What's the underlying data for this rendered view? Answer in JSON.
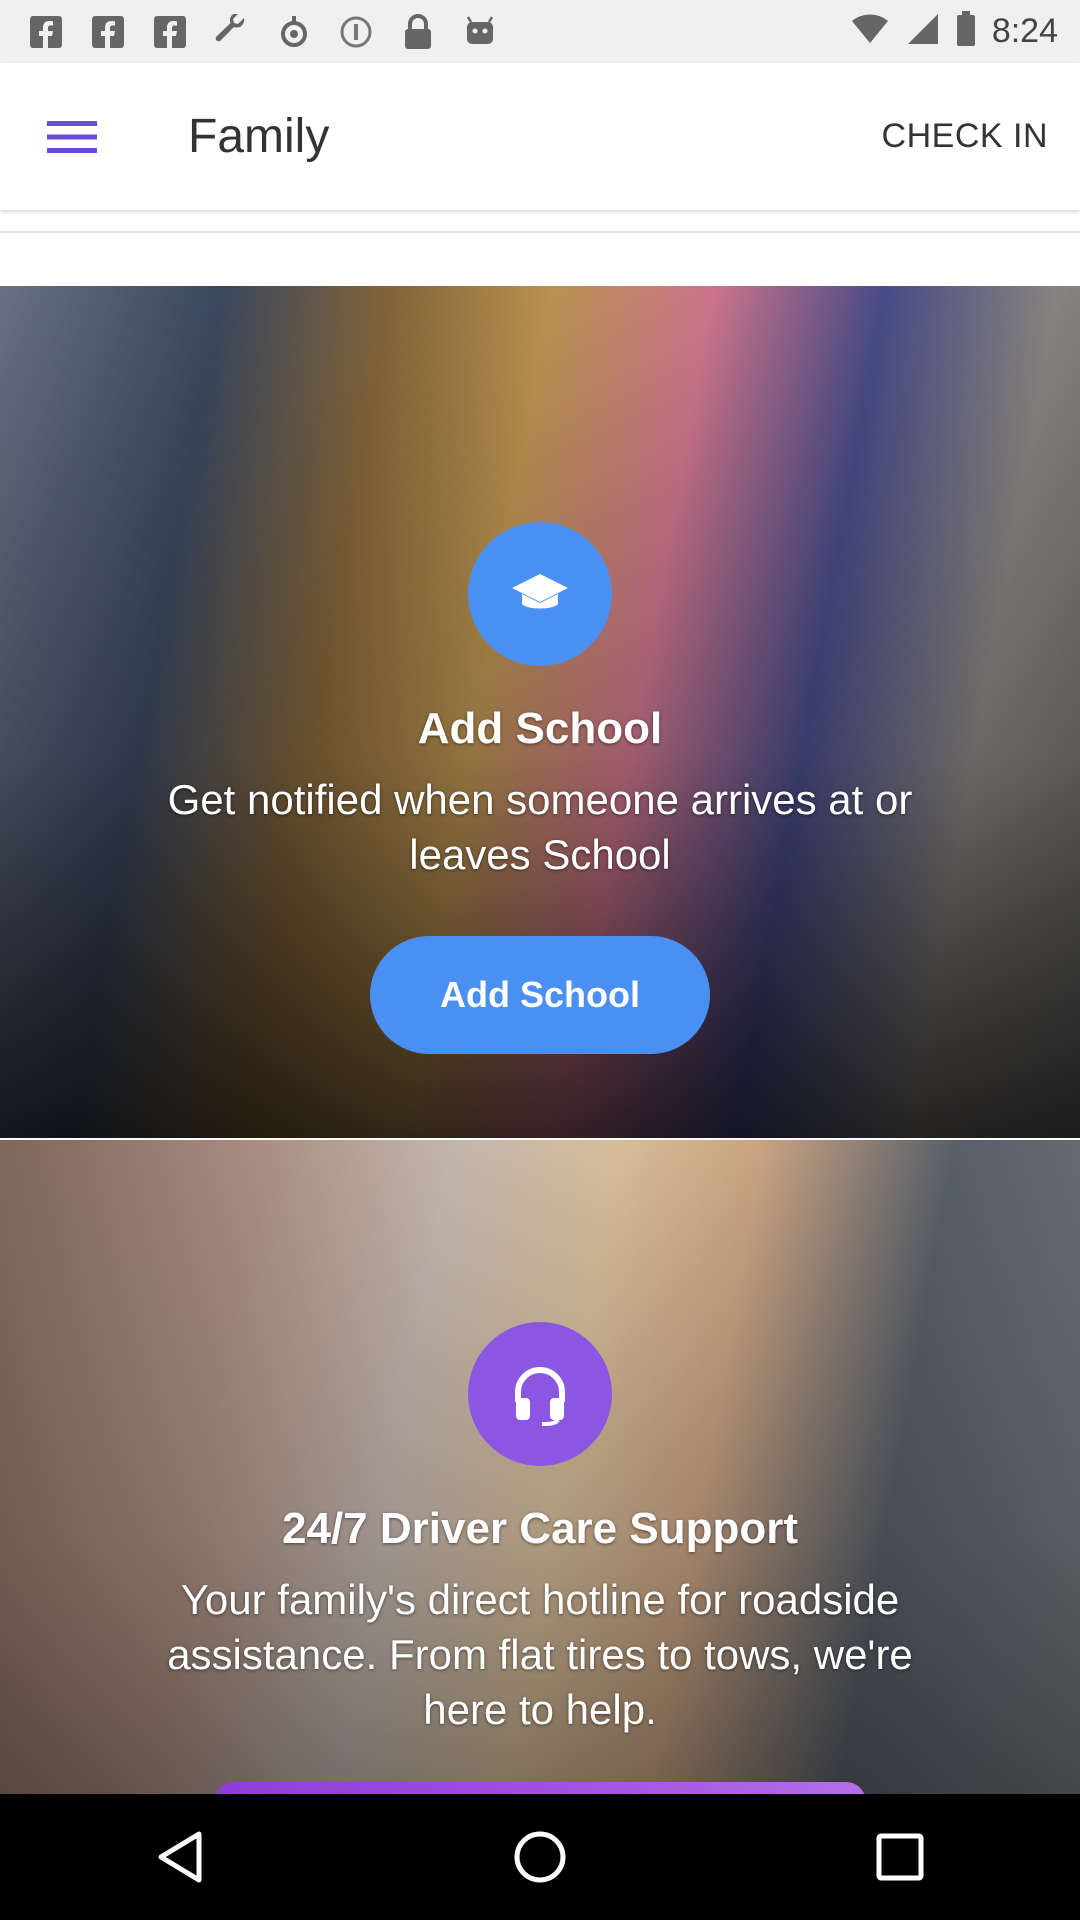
{
  "status_bar": {
    "time": "8:24",
    "icons": [
      "facebook-icon",
      "facebook-icon",
      "facebook-icon",
      "wrench-icon",
      "fake-gps-icon",
      "info-icon",
      "lock-icon",
      "android-icon"
    ]
  },
  "app_bar": {
    "title": "Family",
    "check_in_label": "CHECK IN"
  },
  "school_card": {
    "icon": "graduation-cap-icon",
    "title": "Add School",
    "description": "Get notified when someone arrives at or leaves School",
    "button_label": "Add School",
    "accent": "#4a90f2"
  },
  "support_card": {
    "icon": "headphones-icon",
    "title": "24/7 Driver Care Support",
    "description": "Your family's direct hotline for roadside assistance. From flat tires to tows, we're here to help.",
    "accent": "#8a56e2"
  },
  "nav_bar": {
    "buttons": [
      "back-icon",
      "home-icon",
      "recents-icon"
    ]
  },
  "colors": {
    "menu_icon": "#6a4bd8",
    "status_bar_bg": "#f0f0f0"
  }
}
